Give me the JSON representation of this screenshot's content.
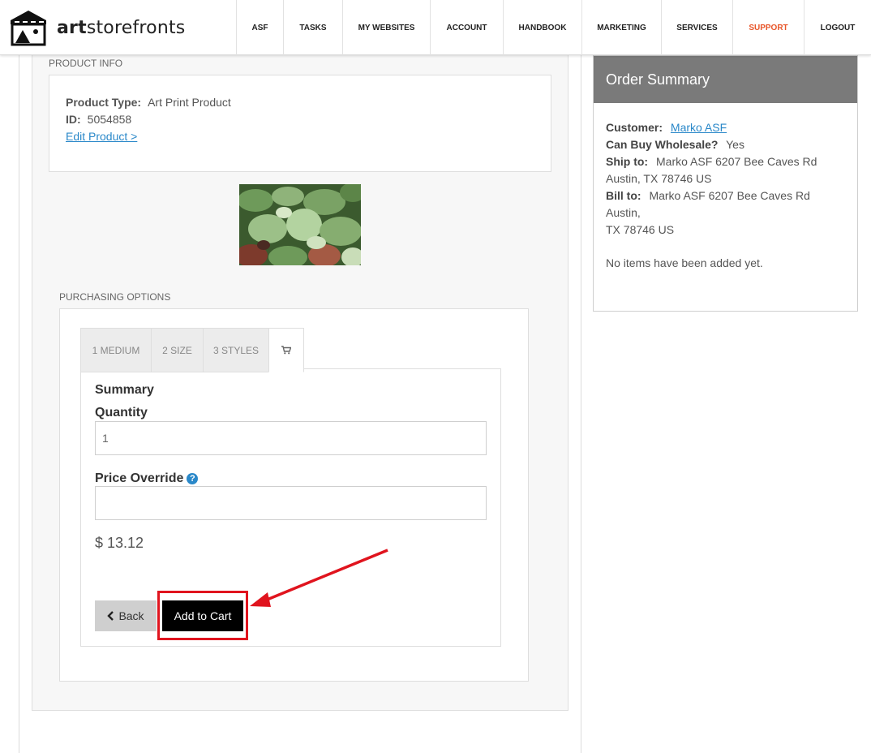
{
  "app": {
    "logo_prefix": "art",
    "logo_suffix": "storefronts"
  },
  "nav": {
    "items": [
      {
        "label": "ASF"
      },
      {
        "label": "TASKS"
      },
      {
        "label": "MY WEBSITES"
      },
      {
        "label": "ACCOUNT"
      },
      {
        "label": "HANDBOOK"
      },
      {
        "label": "MARKETING"
      },
      {
        "label": "SERVICES"
      },
      {
        "label": "SUPPORT",
        "active": true
      },
      {
        "label": "LOGOUT"
      }
    ],
    "active_color": "#e8562a"
  },
  "product_info": {
    "section_label": "PRODUCT INFO",
    "type_label": "Product Type:",
    "type_value": "Art Print Product",
    "id_label": "ID:",
    "id_value": "5054858",
    "edit_link": "Edit Product >"
  },
  "purchasing": {
    "section_label": "PURCHASING OPTIONS",
    "tabs": [
      {
        "label": "1 MEDIUM"
      },
      {
        "label": "2 SIZE"
      },
      {
        "label": "3 STYLES"
      },
      {
        "label": "",
        "icon": "cart-icon",
        "active": true
      }
    ],
    "summary_heading": "Summary",
    "quantity_label": "Quantity",
    "quantity_value": "1",
    "price_override_label": "Price Override",
    "price_override_value": "",
    "price": "$ 13.12",
    "back_label": "Back",
    "add_to_cart_label": "Add to Cart"
  },
  "order_summary": {
    "title": "Order Summary",
    "customer_label": "Customer:",
    "customer_value": "Marko ASF",
    "wholesale_label": "Can Buy Wholesale?",
    "wholesale_value": "Yes",
    "ship_label": "Ship to:",
    "ship_line1": "Marko ASF 6207 Bee Caves Rd",
    "ship_line2": "Austin, TX 78746 US",
    "bill_label": "Bill to:",
    "bill_line1": "Marko ASF 6207 Bee Caves Rd Austin,",
    "bill_line2": "TX 78746 US",
    "empty_text": "No items have been added yet.",
    "header_color": "#7a7a7a"
  },
  "colors": {
    "link": "#2a88c9",
    "highlight": "#e0141e"
  }
}
